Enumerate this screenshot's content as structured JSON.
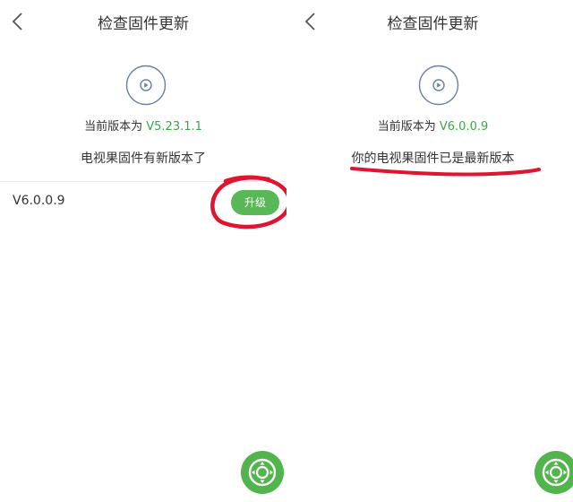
{
  "left": {
    "title": "检查固件更新",
    "current_label": "当前版本为",
    "current_version": "V5.23.1.1",
    "message": "电视果固件有新版本了",
    "new_version": "V6.0.0.9",
    "upgrade_label": "升级"
  },
  "right": {
    "title": "检查固件更新",
    "current_label": "当前版本为",
    "current_version": "V6.0.0.9",
    "message": "你的电视果固件已是最新版本"
  },
  "colors": {
    "accent_green": "#58b756",
    "version_green": "#3aa845",
    "annotation_red": "#e0142f"
  },
  "icons": [
    "back-arrow-icon",
    "play-disc-icon",
    "remote-control-icon"
  ]
}
